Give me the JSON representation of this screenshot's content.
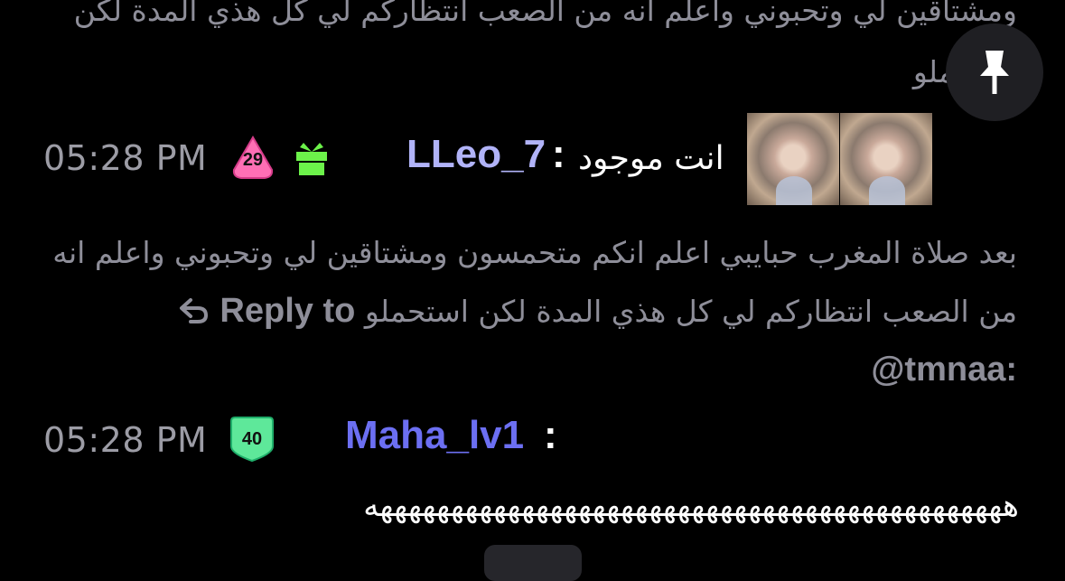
{
  "messages": {
    "continued_text": "ومشتاقين لي وتحبوني واعلم انه من الصعب انتظاركم لي كل هذي المدة لكن استحملو",
    "msg1": {
      "time": "05:28 PM",
      "badge_number": "29",
      "username": "LLeo_7",
      "colon": ":",
      "text": "انت موجود"
    },
    "reply": {
      "label": "Reply to @tmnaa:",
      "text": "بعد صلاة المغرب حبايبي اعلم انكم متحمسون ومشتاقين لي وتحبوني واعلم انه من الصعب انتظاركم لي كل هذي المدة لكن استحملو"
    },
    "msg2": {
      "time": "05:28 PM",
      "badge_number": "40",
      "username": "Maha_lv1",
      "colon": ":",
      "text": "هههههههههههههههههههههههههههههههههههههههههههههه"
    }
  },
  "icons": {
    "pin": "pin-icon",
    "gift": "gift-icon",
    "reply": "reply-arrow-icon"
  },
  "colors": {
    "background": "#000000",
    "username1": "#b1b3f8",
    "username2": "#6c6ff2",
    "badge_pink": "#ff6fb5",
    "badge_green": "#5ee89a",
    "gift": "#6cf24a",
    "muted_text": "#8e8e99"
  }
}
